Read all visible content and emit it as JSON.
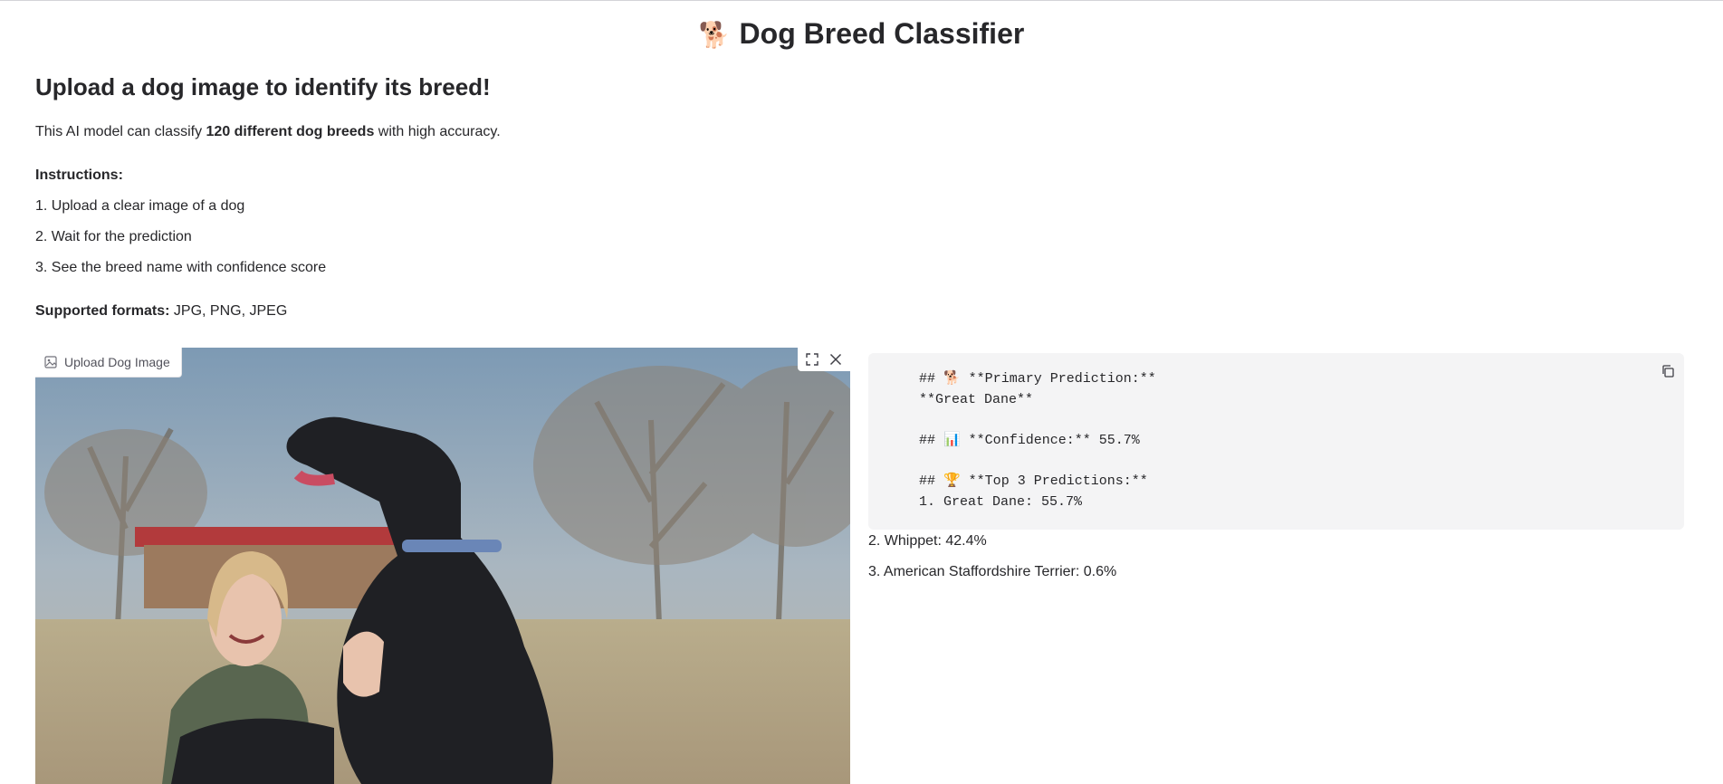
{
  "page": {
    "title_emoji": "🐕",
    "title": "Dog Breed Classifier"
  },
  "intro": {
    "subtitle": "Upload a dog image to identify its breed!",
    "desc_prefix": "This AI model can classify ",
    "desc_bold": "120 different dog breeds",
    "desc_suffix": " with high accuracy.",
    "instructions_label": "Instructions:",
    "steps": [
      "1. Upload a clear image of a dog",
      "2. Wait for the prediction",
      "3. See the breed name with confidence score"
    ],
    "formats_label": "Supported formats:",
    "formats_value": " JPG, PNG, JPEG"
  },
  "image_input": {
    "label": "Upload Dog Image",
    "icons": [
      "image-icon",
      "fullscreen-icon",
      "close-icon"
    ]
  },
  "output": {
    "code_lines": [
      "## 🐕 **Primary Prediction:**",
      "**Great Dane**",
      "",
      "## 📊 **Confidence:** 55.7%",
      "",
      "## 🏆 **Top 3 Predictions:**",
      "1. Great Dane: 55.7%"
    ],
    "extra_lines": [
      "2. Whippet: 42.4%",
      "3. American Staffordshire Terrier: 0.6%"
    ],
    "copy_icon": "copy-icon"
  }
}
